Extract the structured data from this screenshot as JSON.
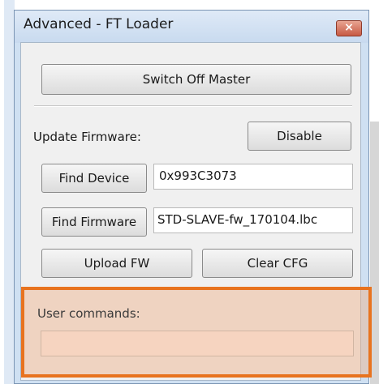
{
  "window": {
    "title": "Advanced - FT Loader",
    "close_glyph": "×"
  },
  "master": {
    "switch_off_label": "Switch Off Master"
  },
  "firmware": {
    "update_label": "Update Firmware:",
    "disable_label": "Disable",
    "find_device_label": "Find Device",
    "device_value": "0x993C3073",
    "find_firmware_label": "Find Firmware",
    "firmware_file_value": "STD-SLAVE-fw_170104.lbc",
    "upload_label": "Upload FW",
    "clear_cfg_label": "Clear CFG"
  },
  "user_commands": {
    "label": "User commands:",
    "value": ""
  },
  "colors": {
    "highlight_border": "#e8731f",
    "window_frame": "#cfe0f2",
    "close_button": "#c75a43"
  }
}
